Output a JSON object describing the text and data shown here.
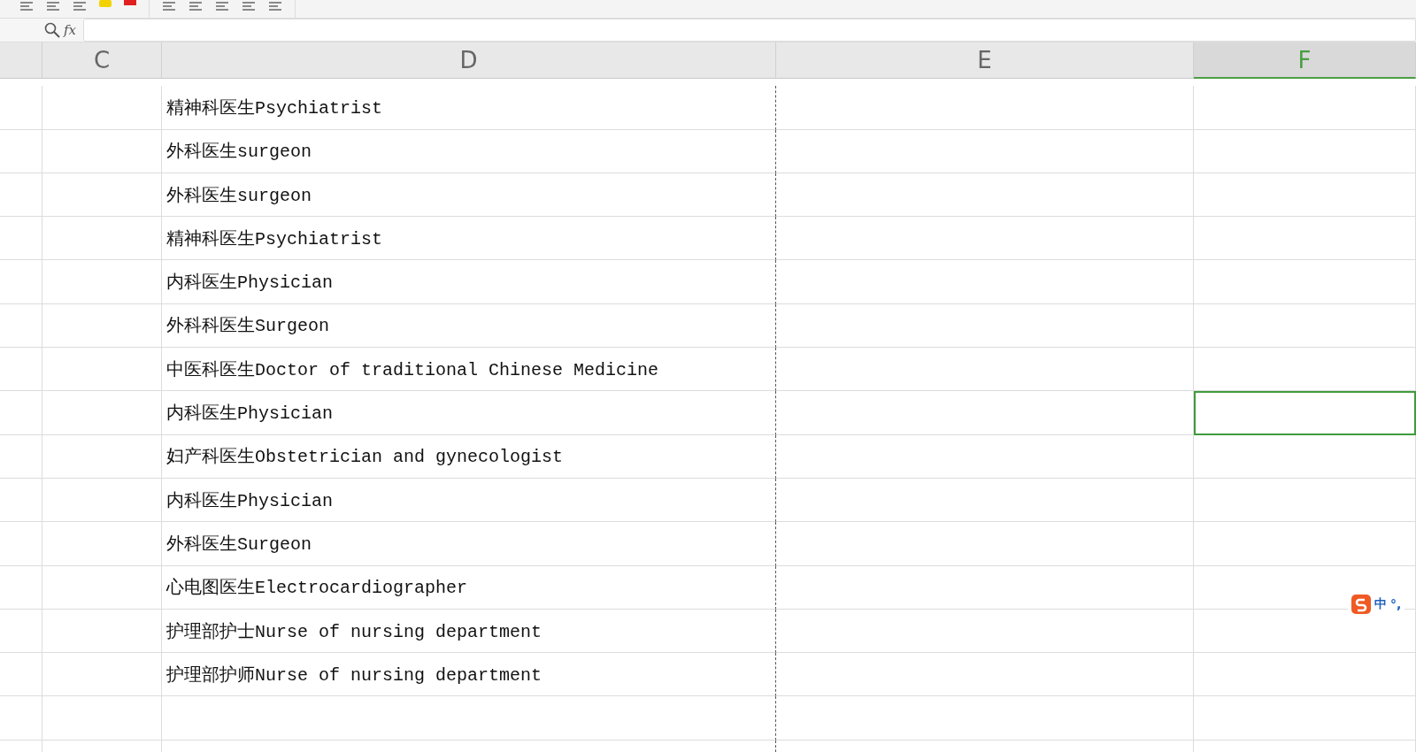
{
  "formula_bar": {
    "label": "fx"
  },
  "columns": [
    {
      "label": "C",
      "selected": false
    },
    {
      "label": "D",
      "selected": false
    },
    {
      "label": "E",
      "selected": false
    },
    {
      "label": "F",
      "selected": true
    }
  ],
  "rows": [
    {
      "text": "精神科医生Psychiatrist",
      "selected": false
    },
    {
      "text": "外科医生surgeon",
      "selected": false
    },
    {
      "text": "外科医生surgeon",
      "selected": false
    },
    {
      "text": "精神科医生Psychiatrist",
      "selected": false
    },
    {
      "text": "内科医生Physician",
      "selected": false
    },
    {
      "text": "外科科医生Surgeon",
      "selected": false
    },
    {
      "text": "中医科医生Doctor of traditional Chinese Medicine",
      "selected": false
    },
    {
      "text": "内科医生Physician",
      "selected": true
    },
    {
      "text": "妇产科医生Obstetrician and gynecologist",
      "selected": false
    },
    {
      "text": "内科医生Physician",
      "selected": false
    },
    {
      "text": "外科医生Surgeon",
      "selected": false
    },
    {
      "text": "心电图医生Electrocardiographer",
      "selected": false
    },
    {
      "text": "护理部护士Nurse of nursing department",
      "selected": false
    },
    {
      "text": "护理部护师Nurse of nursing department",
      "selected": false
    }
  ],
  "ime": {
    "label": "中",
    "punctuation": "°,"
  }
}
